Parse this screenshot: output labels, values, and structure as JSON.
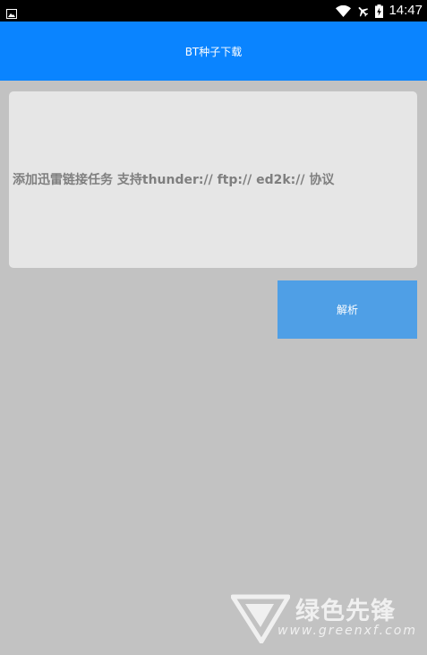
{
  "status_bar": {
    "time": "14:47",
    "icons": [
      "image-icon",
      "wifi-icon",
      "airplane-mode-icon",
      "battery-icon"
    ]
  },
  "app_bar": {
    "title": "BT种子下载"
  },
  "main": {
    "input": {
      "value": "",
      "placeholder": "添加迅雷链接任务 支持thunder:// ftp:// ed2k:// 协议"
    },
    "parse_button_label": "解析"
  },
  "watermark": {
    "title": "绿色先锋",
    "url": "www.greenxf.com"
  },
  "colors": {
    "status_bar": "#000000",
    "app_bar": "#0a84ff",
    "background": "#c2c2c2",
    "input_background": "#e6e6e6",
    "button": "#4f9fe6"
  }
}
